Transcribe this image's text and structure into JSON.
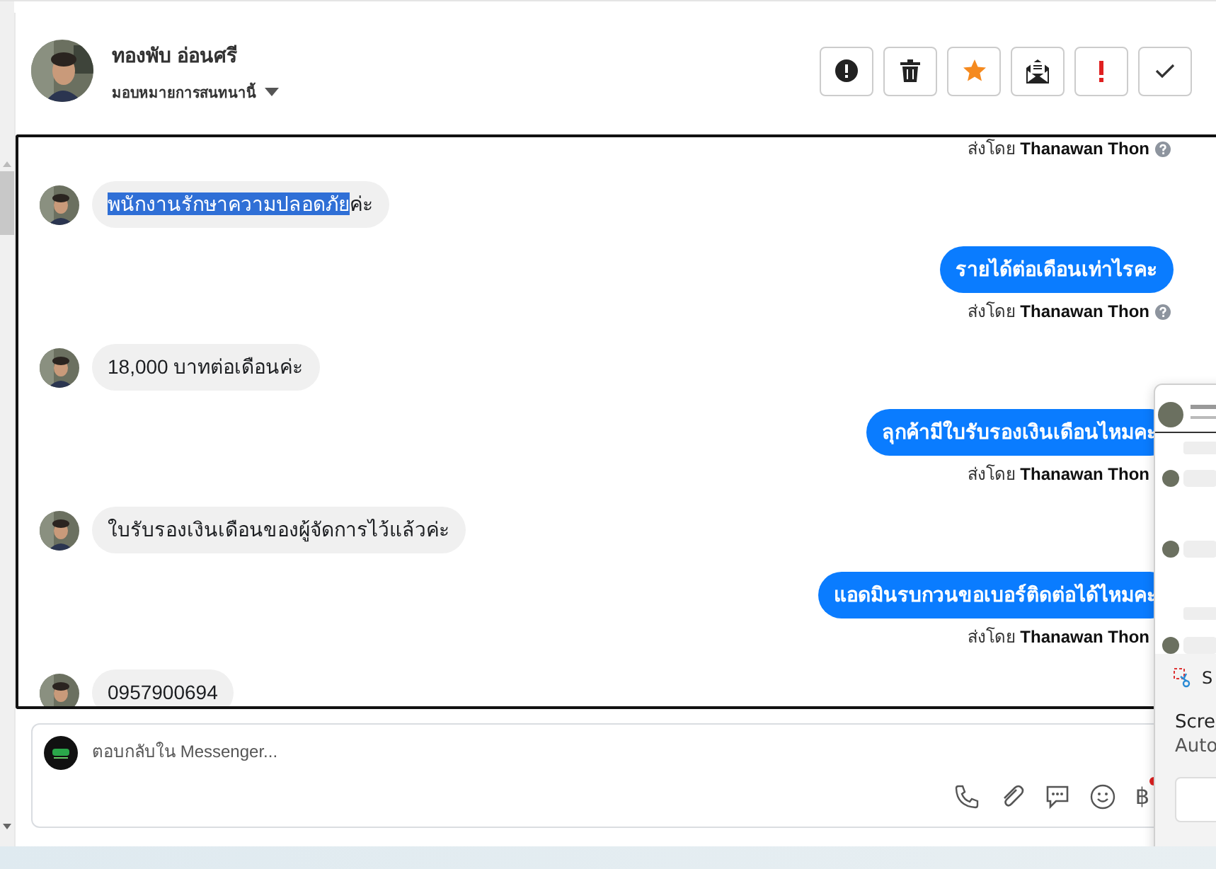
{
  "contact": {
    "name": "ทองพับ อ่อนศรี",
    "assign_label": "มอบหมายการสนทนานี้"
  },
  "toolbar": [
    {
      "kind": "alert"
    },
    {
      "kind": "trash"
    },
    {
      "kind": "star"
    },
    {
      "kind": "mail"
    },
    {
      "kind": "bang"
    },
    {
      "kind": "check"
    }
  ],
  "messages": [
    {
      "kind": "sent_by",
      "text": "ส่งโดย **Thanawan Thon**",
      "info_icon": true
    },
    {
      "kind": "in",
      "parts": [
        {
          "text": "พนักงานรักษาความปลอดภัย",
          "selected": true
        },
        {
          "text": "ค่ะ",
          "selected": false
        }
      ]
    },
    {
      "kind": "out",
      "text": "รายได้ต่อเดือนเท่าไรคะ"
    },
    {
      "kind": "sent_by",
      "text": "ส่งโดย **Thanawan Thon**",
      "info_icon": true
    },
    {
      "kind": "in",
      "parts": [
        {
          "text": "18,000 บาทต่อเดือนค่ะ",
          "selected": false
        }
      ]
    },
    {
      "kind": "out",
      "text": "ลุกค้ามีใบรับรองเงินเดือนไหมคะ"
    },
    {
      "kind": "sent_by",
      "text": "ส่งโดย **Thanawan Thon**",
      "info_icon": false
    },
    {
      "kind": "in",
      "parts": [
        {
          "text": "ใบรับรองเงินเดือนของผู้จัดการไว้แล้วค่ะ",
          "selected": false
        }
      ]
    },
    {
      "kind": "out",
      "text": "แอดมินรบกวนขอเบอร์ติดต่อได้ไหมคะ"
    },
    {
      "kind": "sent_by",
      "text": "ส่งโดย **Thanawan Thon**",
      "info_icon": false
    },
    {
      "kind": "in",
      "parts": [
        {
          "text": "0957900694",
          "selected": false
        }
      ]
    }
  ],
  "composer": {
    "placeholder": "ตอบกลับใน Messenger...",
    "tools": [
      {
        "kind": "phone"
      },
      {
        "kind": "clip"
      },
      {
        "kind": "chat"
      },
      {
        "kind": "smile"
      },
      {
        "kind": "baht",
        "label": "฿"
      }
    ]
  },
  "notification": {
    "app_initial": "S",
    "title": "Scre",
    "body": "Auto"
  }
}
